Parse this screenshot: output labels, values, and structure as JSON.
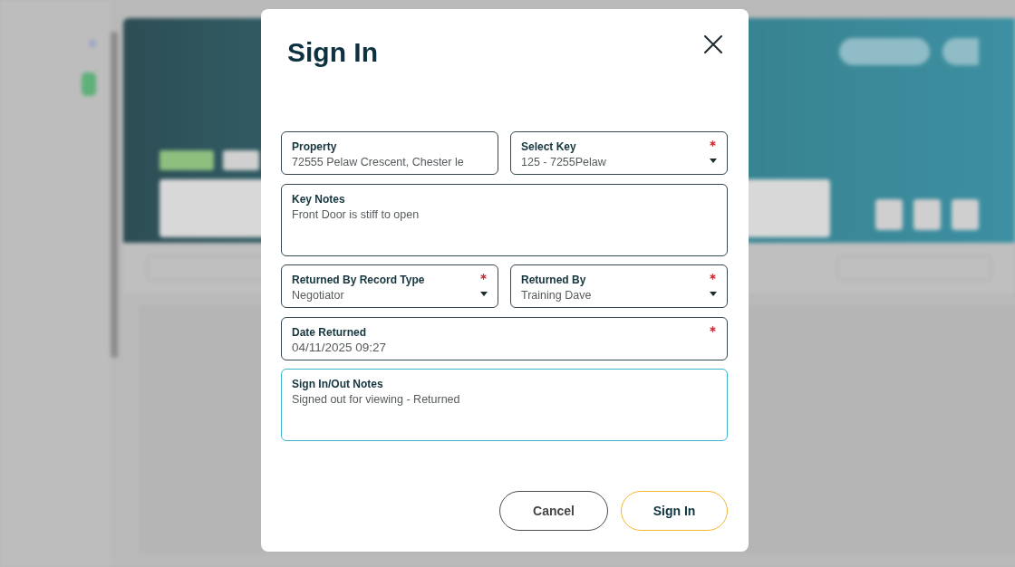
{
  "dialog": {
    "title": "Sign In",
    "rows": [
      {
        "fields": [
          {
            "kind": "input",
            "label": "Property",
            "value": "72555 Pelaw Crescent, Chester le",
            "required": false,
            "focused": false
          },
          {
            "kind": "select",
            "label": "Select Key",
            "value": "125 - 7255Pelaw",
            "required": true,
            "focused": false
          }
        ]
      },
      {
        "fields": [
          {
            "kind": "textarea",
            "label": "Key Notes",
            "value": "Front Door is stiff to open",
            "required": false,
            "focused": false
          }
        ]
      },
      {
        "fields": [
          {
            "kind": "select",
            "label": "Returned By Record Type",
            "value": "Negotiator",
            "required": true,
            "focused": false
          },
          {
            "kind": "select",
            "label": "Returned By",
            "value": "Training Dave",
            "required": true,
            "focused": false
          }
        ]
      },
      {
        "fields": [
          {
            "kind": "input",
            "label": "Date Returned",
            "value": "04/11/2025 09:27",
            "required": true,
            "focused": false
          }
        ]
      },
      {
        "fields": [
          {
            "kind": "textarea",
            "label": "Sign In/Out Notes",
            "value": "Signed out for viewing - Returned",
            "required": false,
            "focused": true
          }
        ]
      }
    ],
    "buttons": [
      {
        "kind": "secondary",
        "label": "Cancel"
      },
      {
        "kind": "primary",
        "label": "Sign In"
      }
    ]
  }
}
